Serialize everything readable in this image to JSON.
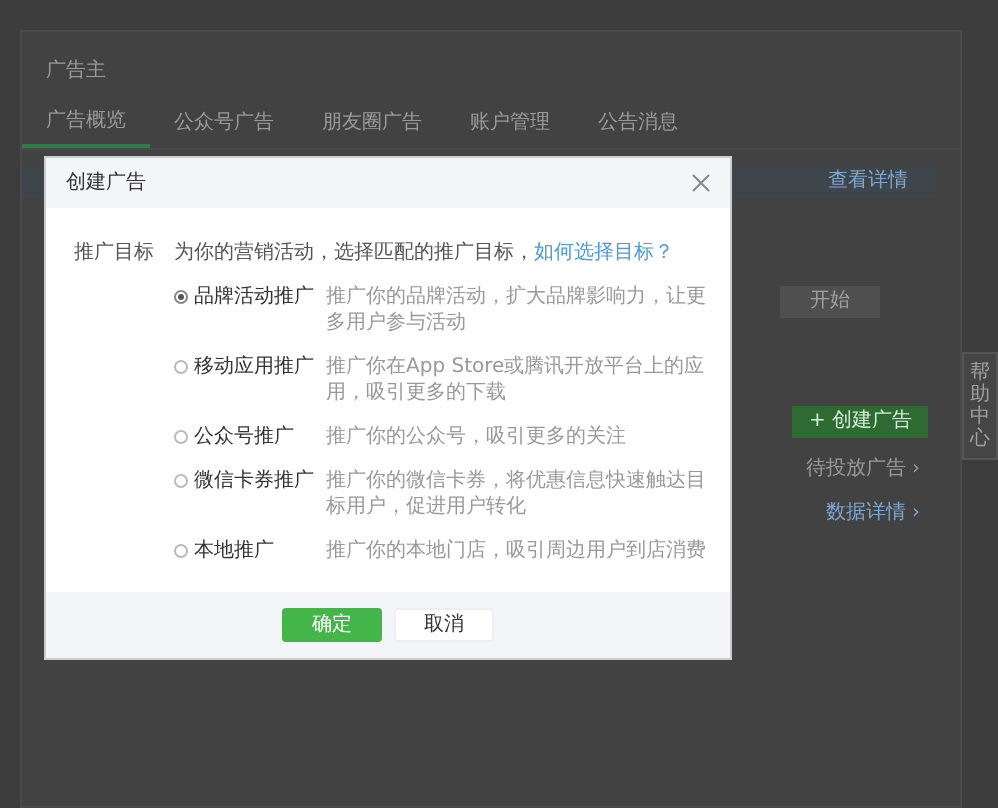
{
  "page": {
    "title": "广告主",
    "tabs": [
      {
        "label": "广告概览",
        "selected": true
      },
      {
        "label": "公众号广告",
        "selected": false
      },
      {
        "label": "朋友圈广告",
        "selected": false
      },
      {
        "label": "账户管理",
        "selected": false
      },
      {
        "label": "公告消息",
        "selected": false
      }
    ],
    "notice_link": "查看详情",
    "start_button": "开始",
    "create_button": "+ 创建广告",
    "pending_link": "待投放广告 ›",
    "detail_link": "数据详情 ›"
  },
  "help_tab": "帮助中心",
  "dialog": {
    "title": "创建广告",
    "field_label": "推广目标",
    "intro": "为你的营销活动，选择匹配的推广目标，",
    "help_link": "如何选择目标？",
    "options": [
      {
        "label": "品牌活动推广",
        "description": "推广你的品牌活动，扩大品牌影响力，让更多用户参与活动",
        "selected": true
      },
      {
        "label": "移动应用推广",
        "description": "推广你在App Store或腾讯开放平台上的应用，吸引更多的下载",
        "selected": false
      },
      {
        "label": "公众号推广",
        "description": "推广你的公众号，吸引更多的关注",
        "selected": false
      },
      {
        "label": "微信卡券推广",
        "description": "推广你的微信卡券，将优惠信息快速触达目标用户，促进用户转化",
        "selected": false
      },
      {
        "label": "本地推广",
        "description": "推广你的本地门店，吸引周边用户到店消费",
        "selected": false
      }
    ],
    "buttons": [
      {
        "label": "确定",
        "kind": "primary"
      },
      {
        "label": "取消",
        "kind": "secondary"
      }
    ]
  }
}
